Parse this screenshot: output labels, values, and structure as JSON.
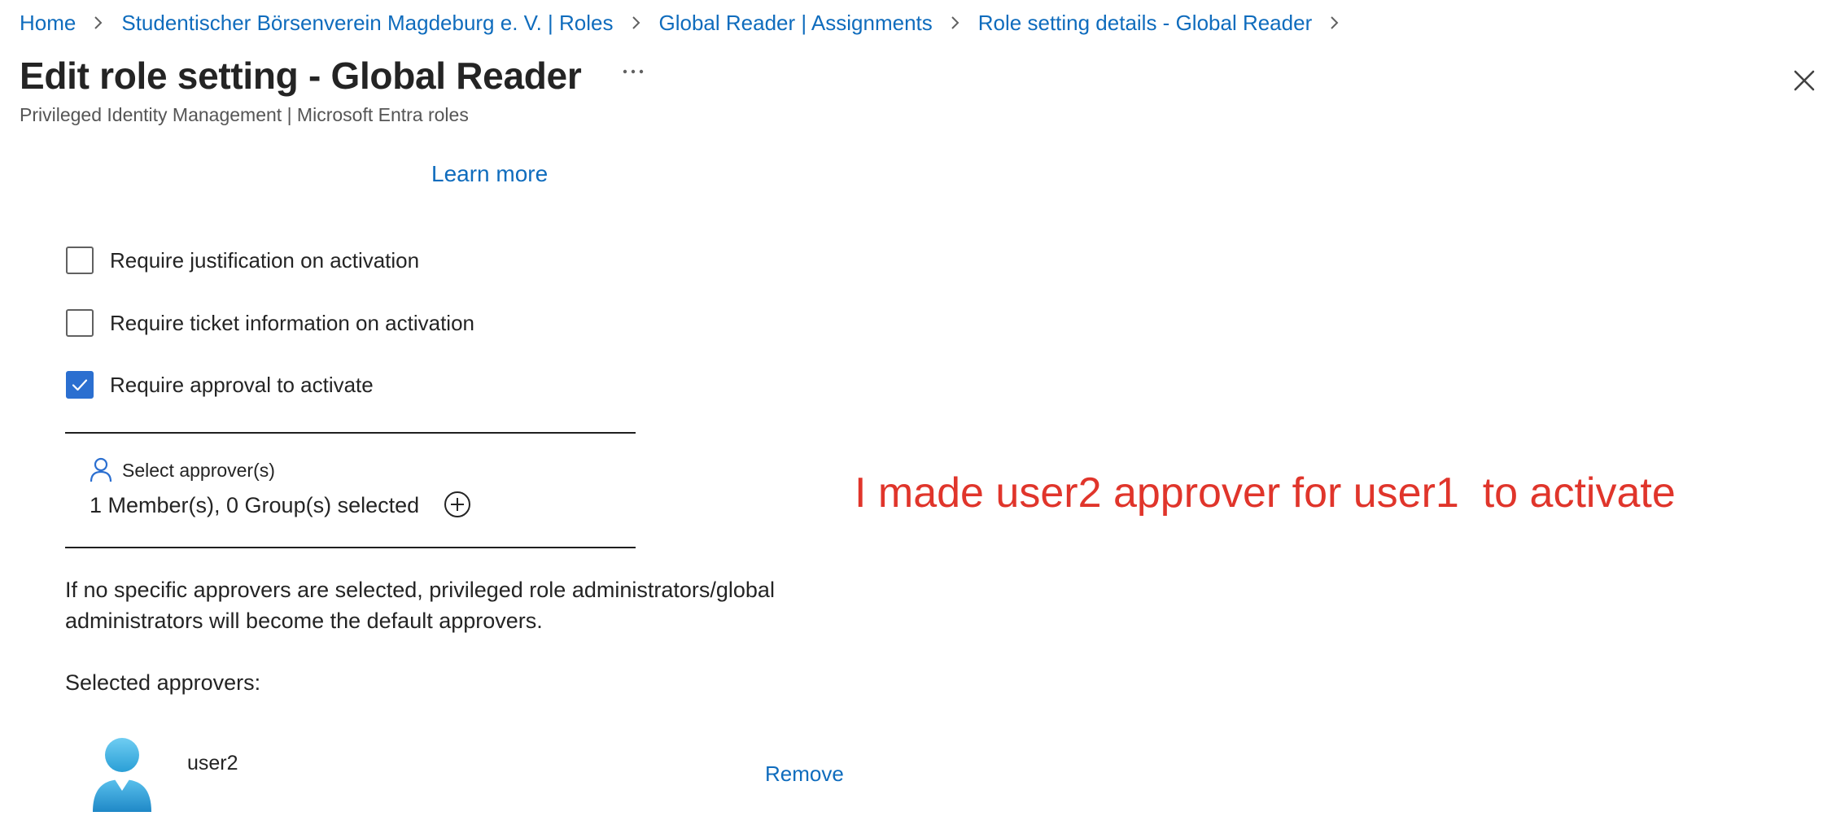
{
  "breadcrumb": [
    {
      "label": "Home"
    },
    {
      "label": "Studentischer Börsenverein Magdeburg e. V. | Roles"
    },
    {
      "label": "Global Reader | Assignments"
    },
    {
      "label": "Role setting details - Global Reader"
    }
  ],
  "header": {
    "title": "Edit role setting - Global Reader",
    "subtitle": "Privileged Identity Management | Microsoft Entra roles",
    "more_label": "..."
  },
  "learn_more": "Learn more",
  "activation_options": [
    {
      "label": "Require justification on activation",
      "checked": false
    },
    {
      "label": "Require ticket information on activation",
      "checked": false
    },
    {
      "label": "Require approval to activate",
      "checked": true
    }
  ],
  "approvers": {
    "select_label": "Select approver(s)",
    "selected_summary": "1 Member(s), 0 Group(s) selected",
    "info_text": "If no specific approvers are selected, privileged role administrators/global administrators will become the default approvers.",
    "selected_heading": "Selected approvers:",
    "list": [
      {
        "name": "user2",
        "action": "Remove"
      }
    ]
  },
  "annotation": "I made user2 approver for user1  to activate",
  "colors": {
    "link": "#0f6cbd",
    "checkbox_checked": "#2b6fd0",
    "annotation": "#e0352b"
  },
  "icons": [
    "chevron-right-icon",
    "more-icon",
    "close-icon",
    "person-icon",
    "add-circle-icon",
    "user-avatar-icon",
    "checkmark-icon"
  ]
}
